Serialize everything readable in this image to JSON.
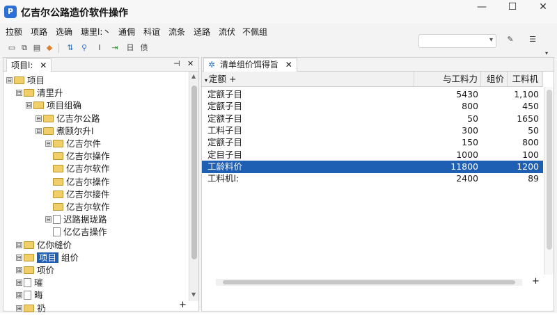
{
  "window": {
    "title": "亿吉尔公路造价软件操作",
    "minimize": "—",
    "maximize": "☐",
    "close": "✕"
  },
  "menu": [
    "拉额",
    "项路",
    "选确",
    "瑭里l:丶",
    "通佣",
    "科谊",
    "流条",
    "迳路",
    "流伏",
    "不佩组"
  ],
  "toolbar": {
    "text_icon_1": "I",
    "text_icon_2": "日",
    "text_icon_3": "债"
  },
  "left_panel": {
    "tab_label": "项目l:",
    "pin": "⊣",
    "close": "✕",
    "add": "+",
    "tree": [
      {
        "label": "项目",
        "depth": 0,
        "expander": "⊟",
        "icon": "folder"
      },
      {
        "label": "清里升",
        "depth": 1,
        "expander": "⊟",
        "icon": "folder"
      },
      {
        "label": "项目组确",
        "depth": 2,
        "expander": "⊟",
        "icon": "folder"
      },
      {
        "label": "亿吉尔公路",
        "depth": 3,
        "expander": "⊟",
        "icon": "folder"
      },
      {
        "label": "煮颐尔升l",
        "depth": 3,
        "expander": "⊟",
        "icon": "folder"
      },
      {
        "label": "亿吉尔件",
        "depth": 4,
        "expander": "⊟",
        "icon": "folder"
      },
      {
        "label": "亿吉尔操作",
        "depth": 4,
        "expander": "",
        "icon": "folder"
      },
      {
        "label": "亿吉尔软作",
        "depth": 4,
        "expander": "",
        "icon": "folder"
      },
      {
        "label": "亿吉尔操作",
        "depth": 4,
        "expander": "",
        "icon": "folder"
      },
      {
        "label": "亿吉尔接件",
        "depth": 4,
        "expander": "",
        "icon": "folder"
      },
      {
        "label": "亿吉尔软作",
        "depth": 4,
        "expander": "",
        "icon": "folder"
      },
      {
        "label": "迟路据珑路",
        "depth": 4,
        "expander": "⊟",
        "icon": "doc"
      },
      {
        "label": "亿亿吉操作",
        "depth": 4,
        "expander": "",
        "icon": "doc"
      },
      {
        "label": "亿你缝价",
        "depth": 1,
        "expander": "⊟",
        "icon": "folder"
      },
      {
        "label": "项目",
        "depth": 1,
        "expander": "⊟",
        "icon": "folder",
        "selected": true,
        "suffix": "组价"
      },
      {
        "label": "项价",
        "depth": 1,
        "expander": "⊞",
        "icon": "folder"
      },
      {
        "label": "璀",
        "depth": 1,
        "expander": "⊞",
        "icon": "doc"
      },
      {
        "label": "晦",
        "depth": 1,
        "expander": "⊞",
        "icon": "doc"
      },
      {
        "label": "礽",
        "depth": 1,
        "expander": "⊞",
        "icon": "folder"
      }
    ]
  },
  "right_panel": {
    "tab_label": "清单组价饵得旨",
    "close": "✕",
    "add": "+",
    "columns": {
      "name": "定额 +",
      "col1": "与工料力",
      "col2": "组价",
      "col3": "工料机"
    },
    "rows": [
      {
        "name": "定额子目",
        "qty": "5430",
        "price": "",
        "total": "1,100"
      },
      {
        "name": "定额子目",
        "qty": "800",
        "price": "",
        "total": "450"
      },
      {
        "name": "定额子目",
        "qty": "50",
        "price": "",
        "total": "1650"
      },
      {
        "name": "工料子目",
        "qty": "300",
        "price": "",
        "total": "50"
      },
      {
        "name": "定额子目",
        "qty": "150",
        "price": "",
        "total": "800"
      },
      {
        "name": "定目子目",
        "qty": "1000",
        "price": "",
        "total": "100"
      },
      {
        "name": "工龄料价",
        "qty": "11800",
        "price": "",
        "total": "1200",
        "selected": true
      },
      {
        "name": "工料机l:",
        "qty": "2400",
        "price": "",
        "total": "89"
      }
    ]
  }
}
